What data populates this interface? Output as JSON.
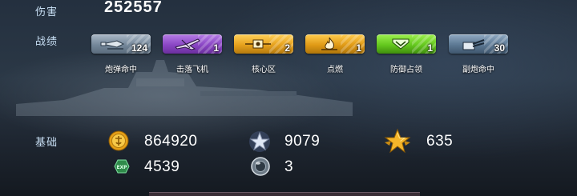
{
  "labels": {
    "damage": "伤害",
    "record": "战绩",
    "basic": "基础"
  },
  "damage_value": "252557",
  "achievements": [
    {
      "label": "炮弹命中",
      "count": "124",
      "icon": "shell-icon",
      "color": "#7f8ea0"
    },
    {
      "label": "击落飞机",
      "count": "1",
      "icon": "plane-icon",
      "color": "#8a46c4"
    },
    {
      "label": "核心区",
      "count": "2",
      "icon": "core-zone-icon",
      "color": "#e6a11d"
    },
    {
      "label": "点燃",
      "count": "1",
      "icon": "fire-icon",
      "color": "#e09a16"
    },
    {
      "label": "防御占领",
      "count": "1",
      "icon": "defend-capture-icon",
      "color": "#64c81e"
    },
    {
      "label": "副炮命中",
      "count": "30",
      "icon": "secondary-gun-icon",
      "color": "#5c7893"
    }
  ],
  "basic_stats": {
    "coins": "864920",
    "exp": "4539",
    "star_points": "9079",
    "gold_star_points": "635",
    "orb_count": "3"
  },
  "icons": {
    "coin": "gold-coin-icon",
    "exp": "exp-badge-icon",
    "silver_star": "silver-star-icon",
    "gold_star": "gold-star-icon",
    "orb": "silver-orb-icon"
  }
}
